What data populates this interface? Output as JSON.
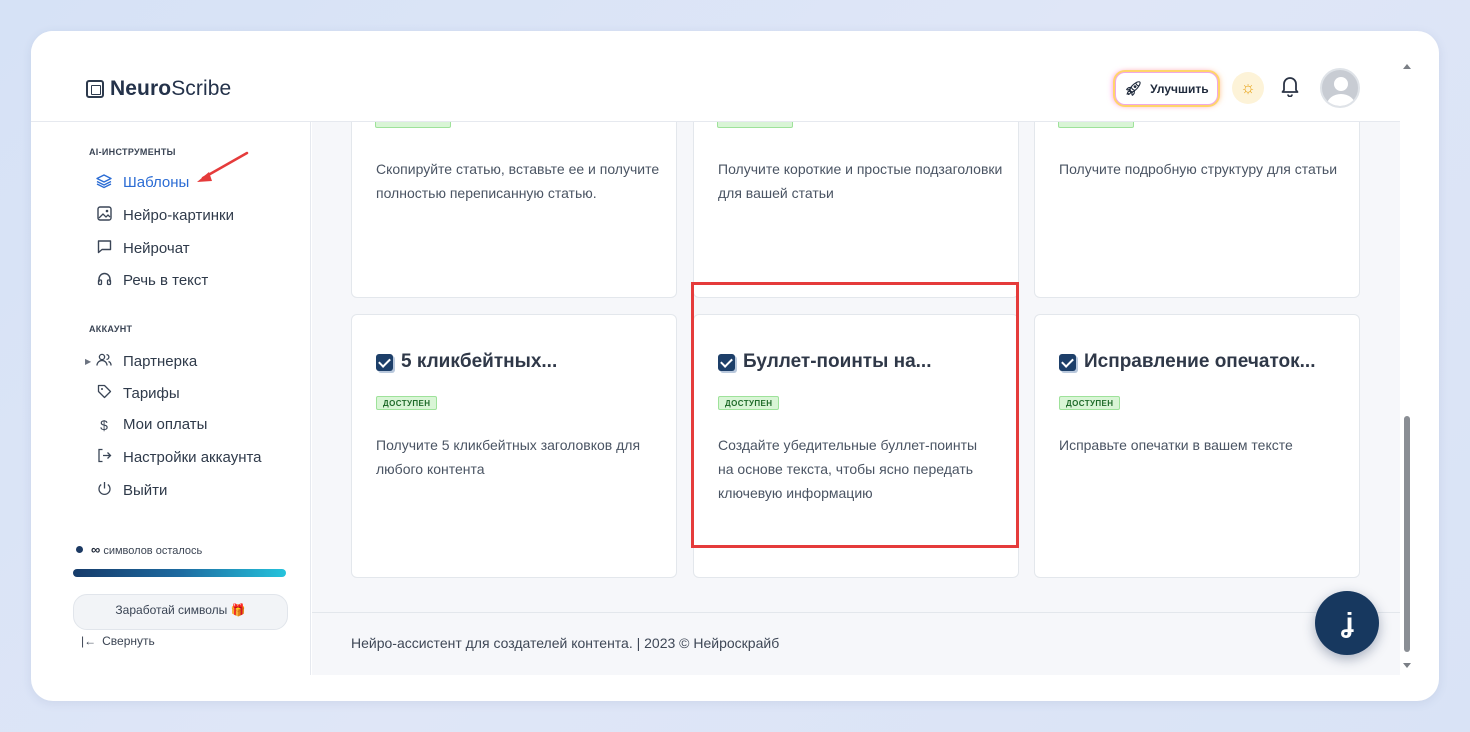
{
  "app": {
    "logo_bold": "Neuro",
    "logo_regular": "Scribe"
  },
  "header": {
    "upgrade_label": "Улучшить",
    "icons": [
      "rocket-icon",
      "sun-icon",
      "bell-icon",
      "avatar"
    ]
  },
  "sidebar": {
    "ai_section": "AI-ИНСТРУМЕНТЫ",
    "ai_items": [
      {
        "label": "Шаблоны",
        "icon": "layers-icon",
        "active": true
      },
      {
        "label": "Нейро-картинки",
        "icon": "image-icon"
      },
      {
        "label": "Нейрочат",
        "icon": "chat-icon"
      },
      {
        "label": "Речь в текст",
        "icon": "headphones-icon"
      }
    ],
    "account_section": "АККАУНТ",
    "account_items": [
      {
        "label": "Партнерка",
        "icon": "users-icon"
      },
      {
        "label": "Тарифы",
        "icon": "tag-icon"
      },
      {
        "label": "Мои оплаты",
        "icon": "dollar-icon"
      },
      {
        "label": "Настройки аккаунта",
        "icon": "login-icon"
      },
      {
        "label": "Выйти",
        "icon": "power-icon"
      }
    ],
    "symbols_value": "∞",
    "symbols_label": "символов осталось",
    "earn_label": "Заработай символы 🎁",
    "collapse_label": "Свернуть"
  },
  "cards_top": [
    {
      "desc": "Скопируйте статью, вставьте ее и получите полностью переписанную статью."
    },
    {
      "desc": "Получите короткие и простые подзаголовки для вашей статьи"
    },
    {
      "desc": "Получите подробную структуру для статьи"
    }
  ],
  "cards": [
    {
      "title": "5 кликбейтных...",
      "badge": "ДОСТУПЕН",
      "desc": "Получите 5 кликбейтных заголовков для любого контента"
    },
    {
      "title": "Буллет-поинты на...",
      "badge": "ДОСТУПЕН",
      "desc": "Создайте убедительные буллет-поинты на основе текста, чтобы ясно передать ключевую информацию"
    },
    {
      "title": "Исправление опечаток...",
      "badge": "ДОСТУПЕН",
      "desc": "Исправьте опечатки в вашем тексте"
    }
  ],
  "footer": {
    "text": "Нейро-ассистент для создателей контента.  | 2023 © Нейроскрайб"
  },
  "colors": {
    "accent": "#2b6cd4",
    "highlight": "#e53b3b",
    "navy": "#17385f",
    "badge_bg": "#d9f5d6"
  }
}
